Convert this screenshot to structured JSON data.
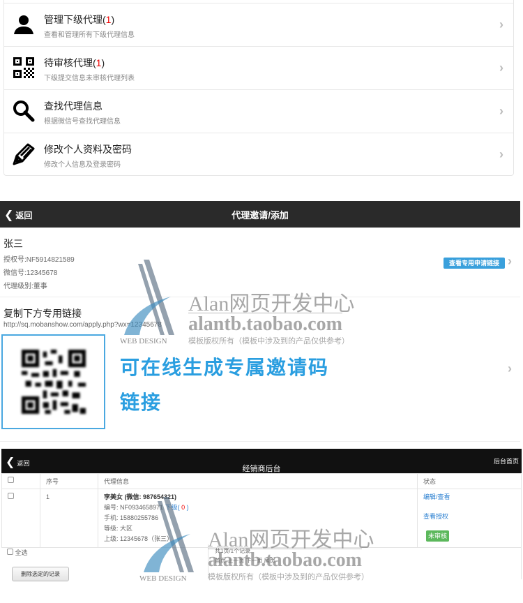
{
  "menu": {
    "items": [
      {
        "icon": "user-icon",
        "title": "管理下级代理",
        "count": "1",
        "subtitle": "查看和管理所有下级代理信息"
      },
      {
        "icon": "qrcode-icon",
        "title": "待审核代理",
        "count": "1",
        "subtitle": "下级提交信息未审核代理列表"
      },
      {
        "icon": "search-icon",
        "title": "查找代理信息",
        "count": null,
        "subtitle": "根据微信号查找代理信息"
      },
      {
        "icon": "pen-icon",
        "title": "修改个人资料及密码",
        "count": null,
        "subtitle": "修改个人信息及登录密码"
      }
    ]
  },
  "invite": {
    "back": "返回",
    "title": "代理邀请/添加",
    "name": "张三",
    "auth_no": "授权号:NF5914821589",
    "wechat": "微信号:12345678",
    "level": "代理级别:董事",
    "view_link_button": "查看专用申请链接",
    "copy_heading": "复制下方专用链接",
    "url": "http://sq.mobanshow.com/apply.php?wx=12345678",
    "promo_line1": "可在线生成专属邀请码",
    "promo_line2": "链接"
  },
  "dealer": {
    "back": "返回",
    "title": "经销商后台",
    "home": "后台首页",
    "columns": [
      "序号",
      "代理信息",
      "状态"
    ],
    "rows": [
      {
        "index": "1",
        "name": "李美女 (微信: 987654321)",
        "code": "编号: NF0934658971",
        "sub_label": "下级(",
        "sub_count": "0",
        "sub_close": ")",
        "phone": "手机: 15880255786",
        "grade": "等级: 大区",
        "parent": "上级: 12345678（张三）",
        "edit": "编辑/查看",
        "view_auth": "查看授权",
        "status": "未审核"
      }
    ],
    "select_all": "全选",
    "page_info": "共1页/1个记录",
    "pager": "首页 上一页 下一页 尾页",
    "delete_button": "删除选定的记录"
  },
  "watermark": {
    "line1": "Alan网页开发中心",
    "line2": "alantb.taobao.com",
    "line3": "模板版权所有（模板中涉及到的产品仅供参考）",
    "logo": "WEB DESIGN"
  },
  "colors": {
    "accent": "#3aa0dc",
    "badge": "#5cb85c",
    "count": "#ee0000"
  }
}
